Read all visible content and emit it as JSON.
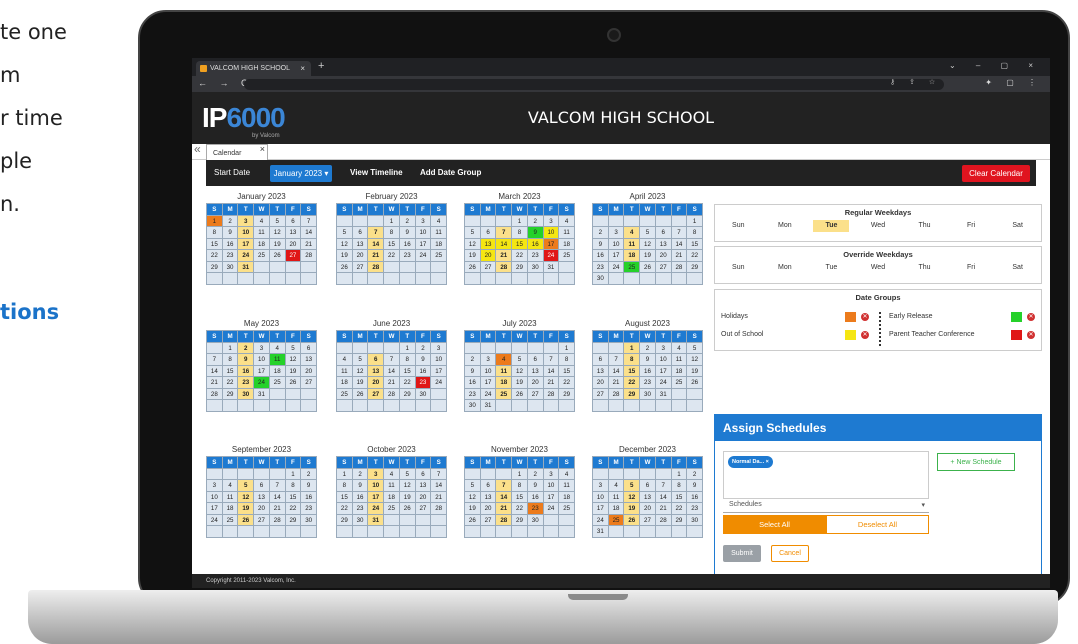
{
  "side_text": {
    "lines": [
      "te one",
      "m",
      "r time",
      "ple",
      "n."
    ],
    "link": "tions"
  },
  "browser": {
    "tab_title": "VALCOM HIGH SCHOOL",
    "tab_close": "×",
    "new_tab": "+",
    "nav": "← → C",
    "window_controls": "⌄ – ▢ ×",
    "addr_icons": "⚷ ⇪ ☆",
    "addr_right": "✦ ▢ ⋮"
  },
  "app": {
    "logo_ip": "IP",
    "logo_num": "6000",
    "logo_sub": "by Valcom",
    "title": "VALCOM HIGH SCHOOL",
    "collapse": "«",
    "tab": "Calendar",
    "tab_close": "×"
  },
  "toolbar": {
    "start_date": "Start Date",
    "month": "January 2023 ▾",
    "view_timeline": "View Timeline",
    "add_date_group": "Add Date Group",
    "clear_calendar": "Clear Calendar"
  },
  "weekday_header": [
    "S",
    "M",
    "T",
    "W",
    "T",
    "F",
    "S"
  ],
  "months": [
    {
      "title": "January 2023",
      "start": 0,
      "days": 31,
      "marks": {
        "1": "o",
        "3": "t",
        "10": "t",
        "17": "t",
        "24": "t",
        "27": "r",
        "31": "t"
      }
    },
    {
      "title": "February 2023",
      "start": 3,
      "days": 28,
      "marks": {
        "7": "t",
        "14": "t",
        "21": "t",
        "28": "t"
      }
    },
    {
      "title": "March 2023",
      "start": 3,
      "days": 31,
      "marks": {
        "7": "t",
        "9": "g",
        "10": "y",
        "13": "y",
        "14": "y",
        "15": "y",
        "16": "y",
        "17": "o",
        "20": "y",
        "21": "t",
        "24": "r",
        "28": "t"
      }
    },
    {
      "title": "April 2023",
      "start": 6,
      "days": 30,
      "marks": {
        "4": "t",
        "11": "t",
        "18": "t",
        "25": "g"
      }
    },
    {
      "title": "May 2023",
      "start": 1,
      "days": 31,
      "marks": {
        "2": "t",
        "9": "t",
        "11": "g",
        "16": "t",
        "23": "t",
        "24": "g",
        "30": "t"
      }
    },
    {
      "title": "June 2023",
      "start": 4,
      "days": 30,
      "marks": {
        "6": "t",
        "13": "t",
        "20": "t",
        "23": "r",
        "27": "t"
      }
    },
    {
      "title": "July 2023",
      "start": 6,
      "days": 31,
      "marks": {
        "4": "o",
        "11": "t",
        "18": "t",
        "25": "t"
      }
    },
    {
      "title": "August 2023",
      "start": 2,
      "days": 31,
      "marks": {
        "1": "t",
        "8": "t",
        "15": "t",
        "22": "t",
        "29": "t"
      }
    },
    {
      "title": "September 2023",
      "start": 5,
      "days": 30,
      "marks": {
        "5": "t",
        "12": "t",
        "19": "t",
        "26": "t"
      }
    },
    {
      "title": "October 2023",
      "start": 0,
      "days": 31,
      "marks": {
        "3": "t",
        "10": "t",
        "17": "t",
        "24": "t",
        "31": "t"
      }
    },
    {
      "title": "November 2023",
      "start": 3,
      "days": 30,
      "marks": {
        "7": "t",
        "14": "t",
        "21": "t",
        "23": "o",
        "28": "t"
      }
    },
    {
      "title": "December 2023",
      "start": 5,
      "days": 31,
      "marks": {
        "5": "t",
        "12": "t",
        "19": "t",
        "25": "o",
        "26": "t"
      }
    }
  ],
  "regular_weekdays": {
    "title": "Regular Weekdays",
    "days": [
      "Sun",
      "Mon",
      "Tue",
      "Wed",
      "Thu",
      "Fri",
      "Sat"
    ],
    "selected": "Tue"
  },
  "override_weekdays": {
    "title": "Override Weekdays",
    "days": [
      "Sun",
      "Mon",
      "Tue",
      "Wed",
      "Thu",
      "Fri",
      "Sat"
    ]
  },
  "date_groups": {
    "title": "Date Groups",
    "remove_icon": "✕",
    "items": [
      {
        "label": "Holidays",
        "color": "#ec7b1c"
      },
      {
        "label": "Out of School",
        "color": "#f5e612"
      },
      {
        "label": "Early Release",
        "color": "#25d12a"
      },
      {
        "label": "Parent Teacher Conference",
        "color": "#e01616"
      }
    ]
  },
  "assign": {
    "title": "Assign Schedules",
    "chip": "Normal Da...",
    "chip_close": "×",
    "new_schedule": "+ New Schedule",
    "schedules_placeholder": "Schedules",
    "caret": "▾",
    "select_all": "Select All",
    "deselect_all": "Deselect All",
    "submit": "Submit",
    "cancel": "Cancel"
  },
  "footer": "Copyright 2011-2023 Valcom, Inc."
}
